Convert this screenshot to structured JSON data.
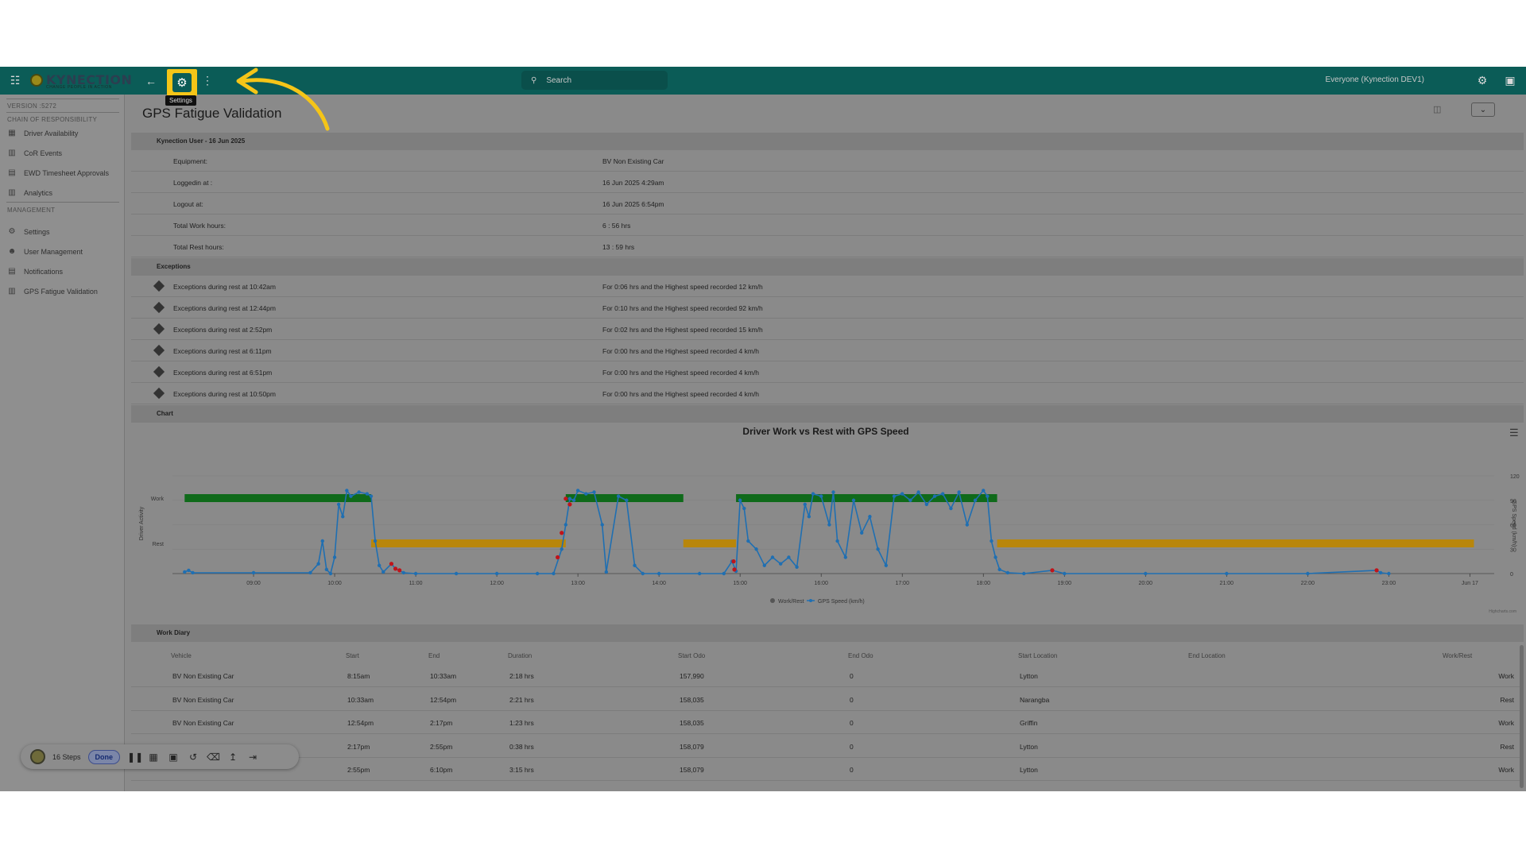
{
  "topbar": {
    "apps_icon": "grid-icon",
    "logo_text": "KYNECTION",
    "logo_tagline": "CHANGE PEOPLE IN ACTION",
    "back_icon": "arrow-left-icon",
    "settings_icon": "gear-icon",
    "settings_tooltip": "Settings",
    "more_icon": "kebab-icon",
    "search_placeholder": "Search",
    "user_label": "Everyone (Kynection DEV1)",
    "highlight_color": "#f5c518",
    "bar_color": "#0b5c57"
  },
  "sidebar": {
    "version": "VERSION :5272",
    "sections": [
      {
        "title": "CHAIN OF RESPONSIBILITY",
        "items": [
          {
            "label": "Driver Availability",
            "icon": "calendar-icon"
          },
          {
            "label": "CoR Events",
            "icon": "bar-chart-icon"
          },
          {
            "label": "EWD Timesheet Approvals",
            "icon": "timesheet-icon"
          },
          {
            "label": "Analytics",
            "icon": "bar-chart-icon"
          }
        ]
      },
      {
        "title": "MANAGEMENT",
        "items": [
          {
            "label": "Settings",
            "icon": "gear-icon"
          },
          {
            "label": "User Management",
            "icon": "users-icon"
          },
          {
            "label": "Notifications",
            "icon": "notification-icon"
          },
          {
            "label": "GPS Fatigue Validation",
            "icon": "bar-chart-icon"
          }
        ]
      }
    ]
  },
  "page": {
    "title": "GPS Fatigue Validation",
    "summary_header": "Kynection User - 16 Jun 2025",
    "summary": [
      {
        "label": "Equipment:",
        "value": "BV Non Existing Car"
      },
      {
        "label": "Loggedin at :",
        "value": "16 Jun 2025 4:29am"
      },
      {
        "label": "Logout at:",
        "value": "16 Jun 2025 6:54pm"
      },
      {
        "label": "Total Work hours:",
        "value": "6 : 56 hrs"
      },
      {
        "label": "Total Rest hours:",
        "value": "13 : 59 hrs"
      }
    ],
    "exceptions_header": "Exceptions",
    "exceptions": [
      {
        "label": "Exceptions during rest at 10:42am",
        "value": "For 0:06 hrs and the Highest speed recorded 12 km/h"
      },
      {
        "label": "Exceptions during rest at 12:44pm",
        "value": "For 0:10 hrs and the Highest speed recorded 92 km/h"
      },
      {
        "label": "Exceptions during rest at 2:52pm",
        "value": "For 0:02 hrs and the Highest speed recorded 15 km/h"
      },
      {
        "label": "Exceptions during rest at 6:11pm",
        "value": "For 0:00 hrs and the Highest speed recorded 4 km/h"
      },
      {
        "label": "Exceptions during rest at 6:51pm",
        "value": "For 0:00 hrs and the Highest speed recorded 4 km/h"
      },
      {
        "label": "Exceptions during rest at 10:50pm",
        "value": "For 0:00 hrs and the Highest speed recorded 4 km/h"
      }
    ],
    "chart_header": "Chart",
    "work_diary_header": "Work Diary"
  },
  "chart_data": {
    "type": "line",
    "title": "Driver Work vs Rest with GPS Speed",
    "ylabel_left": "Driver Activity",
    "ylabel_right": "GPS Speed (km/h)",
    "left_categories": [
      "Rest",
      "Work"
    ],
    "right_ticks": [
      "0",
      "30",
      "60",
      "90",
      "120"
    ],
    "ylim_right": [
      0,
      120
    ],
    "x_tick_labels": [
      "09:00",
      "10:00",
      "11:00",
      "12:00",
      "13:00",
      "14:00",
      "15:00",
      "16:00",
      "17:00",
      "18:00",
      "19:00",
      "20:00",
      "21:00",
      "22:00",
      "23:00",
      "Jun 17"
    ],
    "x_tick_hours": [
      9,
      10,
      11,
      12,
      13,
      14,
      15,
      16,
      17,
      18,
      19,
      20,
      21,
      22,
      23,
      24
    ],
    "xlim_hours": [
      8,
      24.3
    ],
    "legend": [
      "Work/Rest",
      "GPS Speed (km/h)"
    ],
    "legend_position": "bottom",
    "credit": "Highcharts.com",
    "work_rest_segments": [
      {
        "state": "Work",
        "start": 8.15,
        "end": 10.45
      },
      {
        "state": "Rest",
        "start": 10.45,
        "end": 12.85
      },
      {
        "state": "Work",
        "start": 12.85,
        "end": 14.3
      },
      {
        "state": "Rest",
        "start": 14.3,
        "end": 14.95
      },
      {
        "state": "Work",
        "start": 14.95,
        "end": 18.17
      },
      {
        "state": "Rest",
        "start": 18.17,
        "end": 24.05
      }
    ],
    "gps_speed_series": {
      "name": "GPS Speed (km/h)",
      "points": [
        [
          8.15,
          2
        ],
        [
          8.2,
          4
        ],
        [
          8.25,
          1
        ],
        [
          9.0,
          1
        ],
        [
          9.7,
          1
        ],
        [
          9.8,
          12
        ],
        [
          9.85,
          40
        ],
        [
          9.9,
          5
        ],
        [
          9.95,
          0
        ],
        [
          10.0,
          20
        ],
        [
          10.05,
          85
        ],
        [
          10.1,
          70
        ],
        [
          10.15,
          102
        ],
        [
          10.2,
          95
        ],
        [
          10.3,
          100
        ],
        [
          10.4,
          98
        ],
        [
          10.45,
          95
        ],
        [
          10.5,
          40
        ],
        [
          10.55,
          10
        ],
        [
          10.6,
          2
        ],
        [
          10.7,
          12
        ],
        [
          10.75,
          6
        ],
        [
          10.85,
          1
        ],
        [
          11.0,
          0
        ],
        [
          11.5,
          0
        ],
        [
          12.0,
          0
        ],
        [
          12.5,
          0
        ],
        [
          12.7,
          0
        ],
        [
          12.8,
          30
        ],
        [
          12.85,
          60
        ],
        [
          12.9,
          92
        ],
        [
          12.95,
          90
        ],
        [
          13.0,
          102
        ],
        [
          13.1,
          98
        ],
        [
          13.2,
          100
        ],
        [
          13.3,
          60
        ],
        [
          13.35,
          2
        ],
        [
          13.5,
          95
        ],
        [
          13.6,
          90
        ],
        [
          13.7,
          10
        ],
        [
          13.8,
          0
        ],
        [
          14.0,
          0
        ],
        [
          14.5,
          0
        ],
        [
          14.8,
          0
        ],
        [
          14.9,
          15
        ],
        [
          14.95,
          3
        ],
        [
          15.0,
          90
        ],
        [
          15.05,
          80
        ],
        [
          15.1,
          40
        ],
        [
          15.2,
          30
        ],
        [
          15.3,
          10
        ],
        [
          15.4,
          20
        ],
        [
          15.5,
          12
        ],
        [
          15.6,
          20
        ],
        [
          15.7,
          8
        ],
        [
          15.8,
          85
        ],
        [
          15.85,
          70
        ],
        [
          15.9,
          98
        ],
        [
          16.0,
          95
        ],
        [
          16.1,
          60
        ],
        [
          16.15,
          100
        ],
        [
          16.2,
          40
        ],
        [
          16.3,
          20
        ],
        [
          16.4,
          90
        ],
        [
          16.5,
          50
        ],
        [
          16.6,
          70
        ],
        [
          16.7,
          30
        ],
        [
          16.8,
          10
        ],
        [
          16.9,
          95
        ],
        [
          17.0,
          98
        ],
        [
          17.1,
          90
        ],
        [
          17.2,
          100
        ],
        [
          17.3,
          85
        ],
        [
          17.4,
          95
        ],
        [
          17.5,
          98
        ],
        [
          17.6,
          80
        ],
        [
          17.7,
          100
        ],
        [
          17.8,
          60
        ],
        [
          17.9,
          90
        ],
        [
          18.0,
          102
        ],
        [
          18.05,
          95
        ],
        [
          18.1,
          40
        ],
        [
          18.15,
          20
        ],
        [
          18.2,
          5
        ],
        [
          18.3,
          1
        ],
        [
          18.5,
          0
        ],
        [
          18.85,
          4
        ],
        [
          19.0,
          0
        ],
        [
          20.0,
          0
        ],
        [
          21.0,
          0
        ],
        [
          22.0,
          0
        ],
        [
          22.85,
          4
        ],
        [
          22.9,
          1
        ],
        [
          23.0,
          0
        ]
      ]
    },
    "exception_points": [
      [
        10.7,
        12
      ],
      [
        10.75,
        6
      ],
      [
        10.8,
        4
      ],
      [
        12.75,
        20
      ],
      [
        12.8,
        50
      ],
      [
        12.85,
        92
      ],
      [
        12.9,
        85
      ],
      [
        14.92,
        15
      ],
      [
        14.93,
        5
      ],
      [
        18.85,
        4
      ],
      [
        22.85,
        4
      ]
    ],
    "colors": {
      "work": "#0f6a1a",
      "rest": "#b8860b",
      "speed": "#1f6fb2",
      "exception": "#c0141a"
    }
  },
  "work_diary": {
    "columns": [
      "Vehicle",
      "Start",
      "End",
      "Duration",
      "Start Odo",
      "End Odo",
      "Start Location",
      "End Location",
      "Work/Rest"
    ],
    "rows": [
      [
        "BV Non Existing Car",
        "8:15am",
        "10:33am",
        "2:18 hrs",
        "157,990",
        "0",
        "Lytton",
        "",
        "Work"
      ],
      [
        "BV Non Existing Car",
        "10:33am",
        "12:54pm",
        "2:21 hrs",
        "158,035",
        "0",
        "Narangba",
        "",
        "Rest"
      ],
      [
        "BV Non Existing Car",
        "12:54pm",
        "2:17pm",
        "1:23 hrs",
        "158,035",
        "0",
        "Griffin",
        "",
        "Work"
      ],
      [
        "",
        "2:17pm",
        "2:55pm",
        "0:38 hrs",
        "158,079",
        "0",
        "Lytton",
        "",
        "Rest"
      ],
      [
        "",
        "2:55pm",
        "6:10pm",
        "3:15 hrs",
        "158,079",
        "0",
        "Lytton",
        "",
        "Work"
      ]
    ]
  },
  "recorder": {
    "steps": "16 Steps",
    "done": "Done"
  }
}
